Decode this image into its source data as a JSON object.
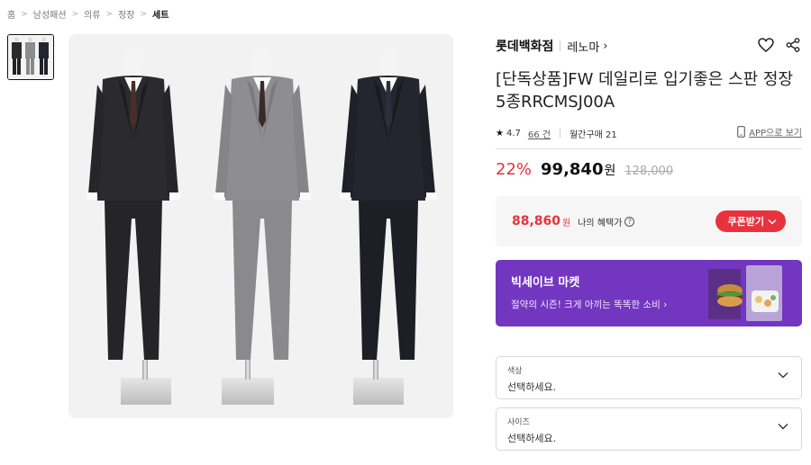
{
  "breadcrumb": [
    "홈",
    "남성패션",
    "의류",
    "정장",
    "세트"
  ],
  "product": {
    "brand": "롯데백화점",
    "sub_brand": "레노마",
    "title": "[단독상품]FW 데일리로 입기좋은 스판 정장5종RRCMSJ00A",
    "rating": "4.7",
    "review_count": "66 건",
    "monthly_sales": "월간구매 21",
    "app_link": "APP으로 보기"
  },
  "price": {
    "discount": "22%",
    "sale": "99,840",
    "won": "원",
    "original": "128,000"
  },
  "benefit": {
    "price": "88,860",
    "won": "원",
    "label": "나의 혜택가",
    "coupon_button": "쿠폰받기"
  },
  "banner": {
    "title": "빅세이브 마켓",
    "subtitle": "절약의 시즌! 크게 아끼는 똑똑한 소비",
    "background": "#7336c0"
  },
  "options": [
    {
      "label": "색상",
      "value": "선택하세요."
    },
    {
      "label": "사이즈",
      "value": "선택하세요."
    }
  ],
  "colors": {
    "accent": "#e8323e",
    "banner": "#7336c0"
  },
  "icons": [
    "heart-icon",
    "share-icon",
    "star-icon",
    "phone-icon",
    "info-icon",
    "chevron-down-icon"
  ]
}
